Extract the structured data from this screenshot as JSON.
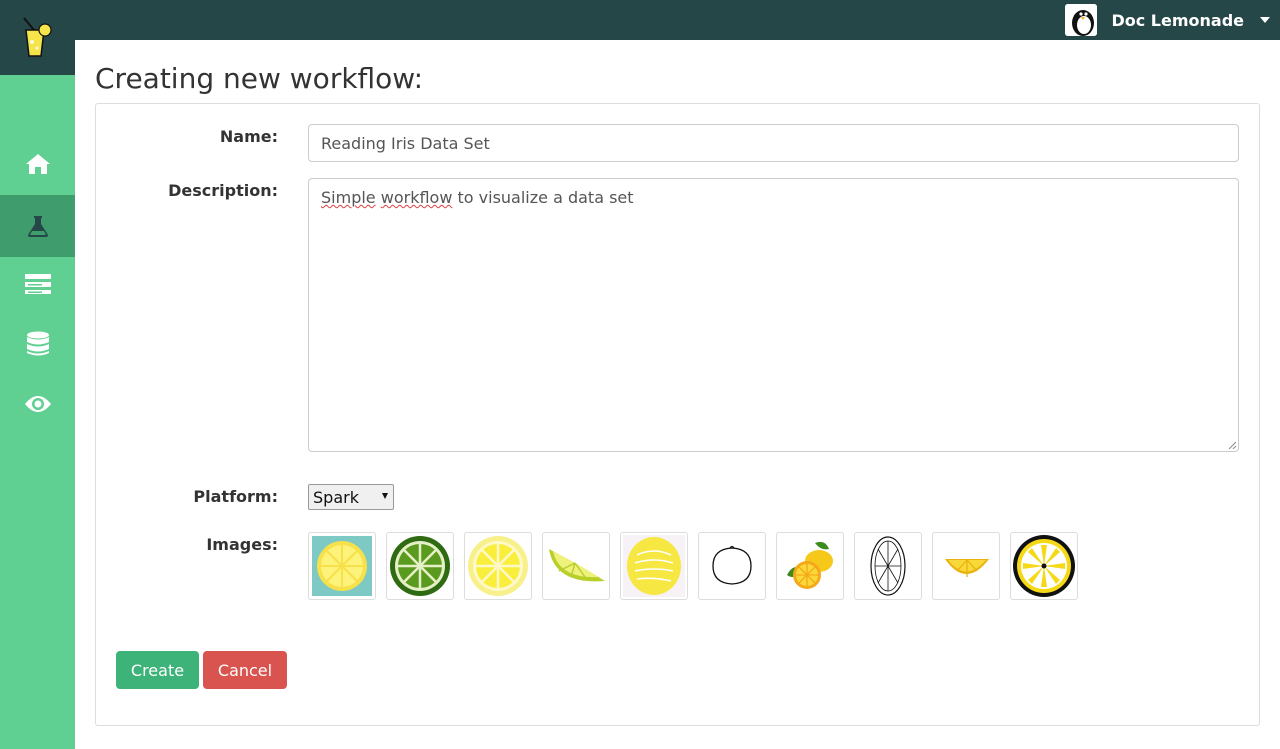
{
  "header": {
    "user_name": "Doc Lemonade"
  },
  "sidebar": {
    "items": [
      {
        "icon": "home-icon"
      },
      {
        "icon": "flask-icon",
        "active": true
      },
      {
        "icon": "server-icon"
      },
      {
        "icon": "database-icon"
      },
      {
        "icon": "eye-icon"
      }
    ]
  },
  "page": {
    "title": "Creating new workflow:"
  },
  "form": {
    "name_label": "Name:",
    "name_value": "Reading Iris Data Set",
    "description_label": "Description:",
    "description_word1": "Simple",
    "description_word2": "workflow",
    "description_rest": "to visualize a data set",
    "platform_label": "Platform:",
    "platform_value": "Spark",
    "images_label": "Images:",
    "images": [
      "lemon-slice-teal-icon",
      "lime-slice-icon",
      "lemon-slice-pale-icon",
      "lime-wedge-icon",
      "lemon-lettered-icon",
      "lemon-outline-icon",
      "lemons-leaves-icon",
      "lemon-slice-sketch-icon",
      "lemon-half-wedge-icon",
      "lemon-slice-bold-icon"
    ],
    "create_label": "Create",
    "cancel_label": "Cancel"
  },
  "colors": {
    "topbar": "#264747",
    "sidebar": "#5fcf92",
    "sidebar_active": "#3f9c6c",
    "create": "#3db37a",
    "cancel": "#d9534f"
  }
}
